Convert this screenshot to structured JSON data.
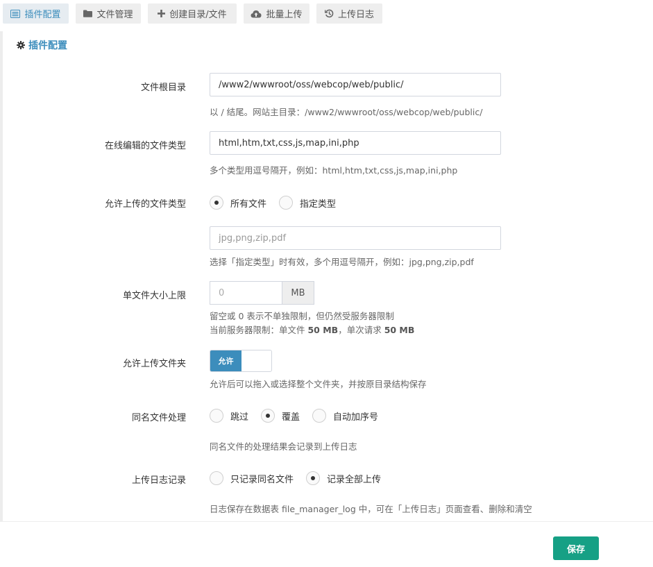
{
  "tabs": [
    {
      "label": "插件配置",
      "icon": "list-icon",
      "active": true
    },
    {
      "label": "文件管理",
      "icon": "folder-icon"
    },
    {
      "label": "创建目录/文件",
      "icon": "plus-icon"
    },
    {
      "label": "批量上传",
      "icon": "cloud-upload-icon"
    },
    {
      "label": "上传日志",
      "icon": "history-icon"
    }
  ],
  "panel": {
    "title": "插件配置",
    "icon": "gear-icon"
  },
  "form": {
    "root_dir": {
      "label": "文件根目录",
      "value": "/www2/wwwroot/oss/webcop/web/public/",
      "help": "以 / 结尾。网站主目录：/www2/wwwroot/oss/webcop/web/public/"
    },
    "edit_types": {
      "label": "在线编辑的文件类型",
      "value": "html,htm,txt,css,js,map,ini,php",
      "help": "多个类型用逗号隔开，例如：html,htm,txt,css,js,map,ini,php"
    },
    "upload_types": {
      "label": "允许上传的文件类型",
      "options": [
        "所有文件",
        "指定类型"
      ],
      "selected": "所有文件",
      "placeholder": "jpg,png,zip,pdf",
      "help": "选择「指定类型」时有效，多个用逗号隔开，例如：jpg,png,zip,pdf"
    },
    "max_size": {
      "label": "单文件大小上限",
      "placeholder": "0",
      "unit": "MB",
      "help1": "留空或 0 表示不单独限制，但仍然受服务器限制",
      "help2_prefix": "当前服务器限制：单文件 ",
      "help2_file": "50 MB",
      "help2_mid": "，单次请求 ",
      "help2_req": "50 MB"
    },
    "folder_upload": {
      "label": "允许上传文件夹",
      "switch_label": "允许",
      "help": "允许后可以拖入或选择整个文件夹，并按原目录结构保存"
    },
    "same_name": {
      "label": "同名文件处理",
      "options": [
        "跳过",
        "覆盖",
        "自动加序号"
      ],
      "selected": "覆盖",
      "help": "同名文件的处理结果会记录到上传日志"
    },
    "log_mode": {
      "label": "上传日志记录",
      "options": [
        "只记录同名文件",
        "记录全部上传"
      ],
      "selected": "记录全部上传",
      "help": "日志保存在数据表 file_manager_log 中，可在「上传日志」页面查看、删除和清空"
    }
  },
  "footer": {
    "save_label": "保存"
  },
  "colors": {
    "accent": "#3c8dbc",
    "save": "#16a085"
  }
}
